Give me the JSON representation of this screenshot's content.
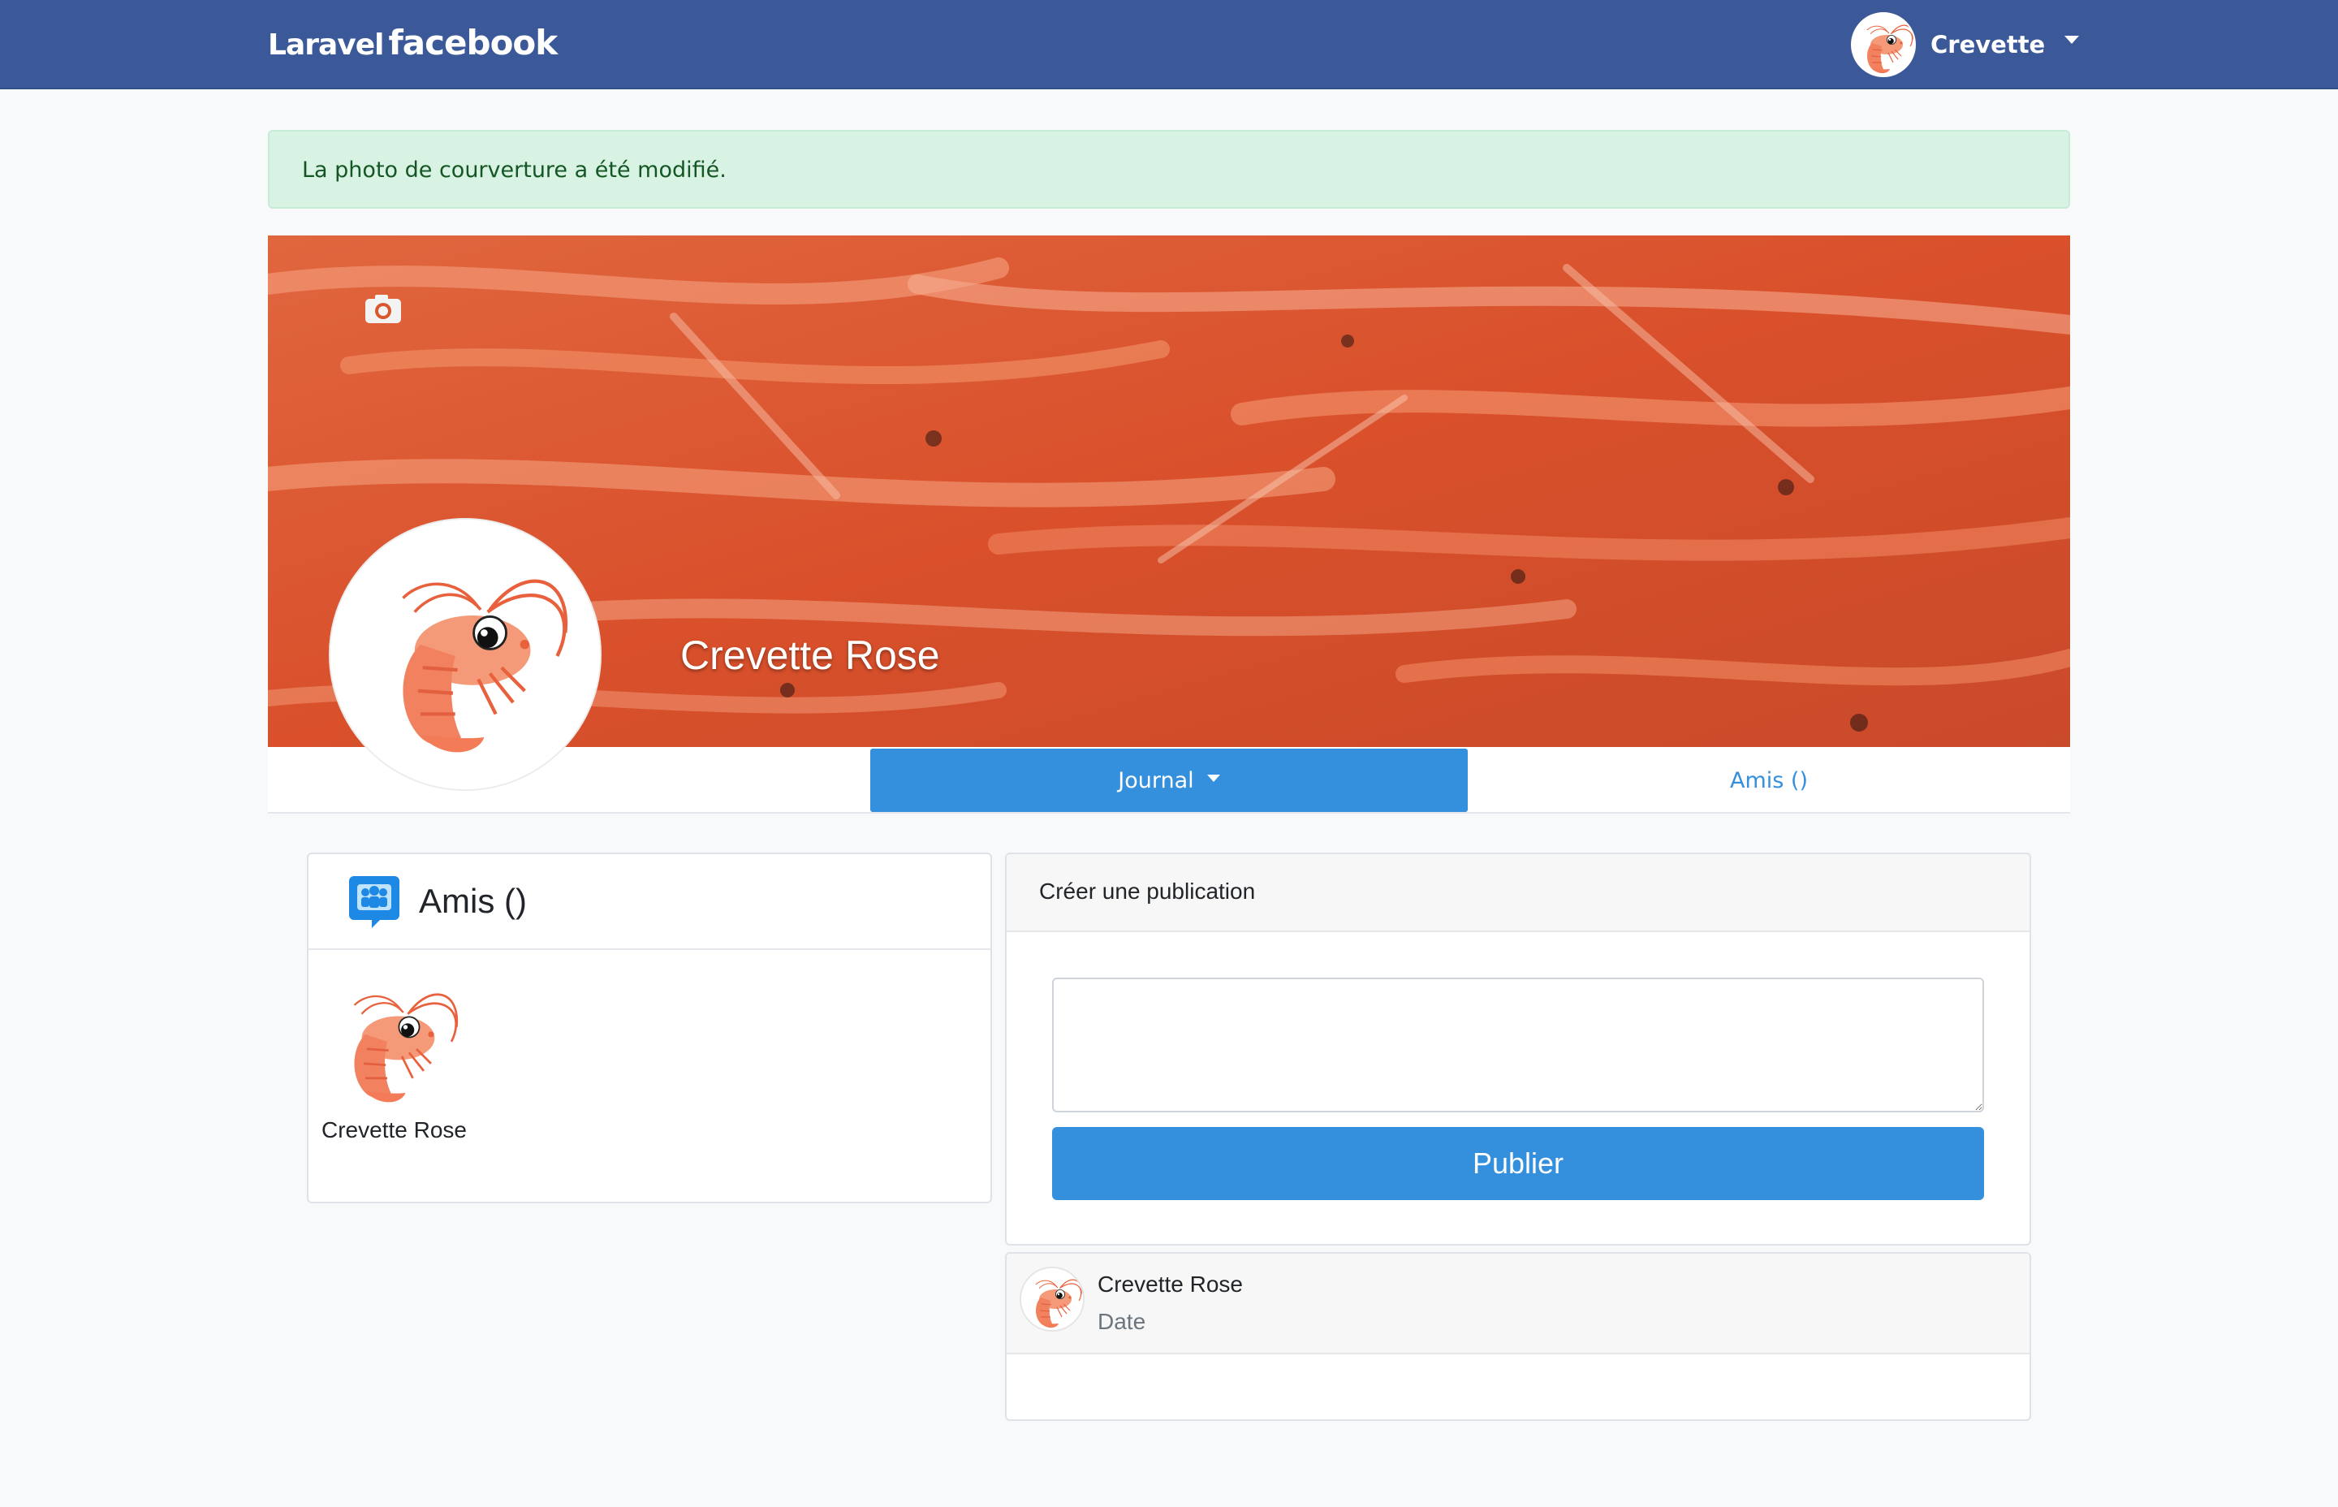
{
  "navbar": {
    "brand_prefix": "Laravel",
    "brand_suffix": "facebook",
    "user_name": "Crevette"
  },
  "alert": {
    "message": "La photo de courverture a été modifié."
  },
  "profile": {
    "name": "Crevette Rose"
  },
  "tabs": {
    "journal": "Journal",
    "amis": "Amis ()"
  },
  "friends": {
    "title": "Amis ()",
    "items": [
      {
        "name": "Crevette Rose"
      }
    ]
  },
  "create_post": {
    "title": "Créer une publication",
    "textarea_value": "",
    "publish_label": "Publier"
  },
  "feed": {
    "posts": [
      {
        "author": "Crevette Rose",
        "date": "Date"
      }
    ]
  },
  "colors": {
    "navbar": "#3b5998",
    "primary": "#3490dc",
    "alert_bg": "#d8f2e3",
    "alert_text": "#155724"
  },
  "icons": {
    "camera": "camera-icon",
    "friends": "friends-group-icon",
    "avatar": "shrimp-avatar"
  }
}
